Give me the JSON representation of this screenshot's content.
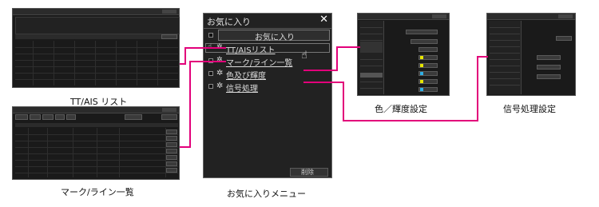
{
  "captions": {
    "tt_ais": "TT/AIS リスト",
    "mark_line": "マーク/ライン一覧",
    "favorites_menu": "お気に入りメニュー",
    "color": "色／輝度設定",
    "signal": "信号処理設定"
  },
  "favorites": {
    "title": "お気に入り",
    "close_glyph": "✕",
    "add_label": "お気に入り",
    "items": [
      {
        "label": "TT/AISリスト"
      },
      {
        "label": "マーク/ライン一覧"
      },
      {
        "label": "色及び輝度"
      },
      {
        "label": "信号処理"
      }
    ],
    "delete_label": "削除"
  },
  "accent_color": "#e2007a"
}
